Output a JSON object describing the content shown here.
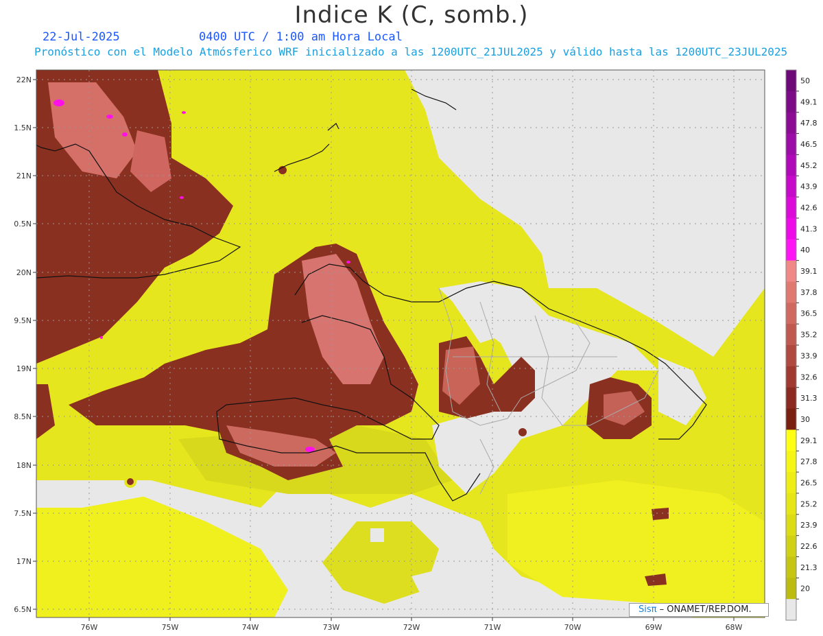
{
  "header": {
    "title": "Indice K (C, somb.)",
    "date": "22-Jul-2025",
    "time": "0400 UTC / 1:00 am Hora Local",
    "model": "Pronóstico con el Modelo Atmósferico WRF inicializado a las 1200UTC_21JUL2025 y válido hasta las  1200UTC_23JUL2025"
  },
  "axes": {
    "lat_labels": [
      "22N",
      "1.5N",
      "21N",
      "0.5N",
      "20N",
      "9.5N",
      "19N",
      "8.5N",
      "18N",
      "7.5N",
      "17N",
      "6.5N"
    ],
    "lon_labels": [
      "76W",
      "75W",
      "74W",
      "73W",
      "72W",
      "71W",
      "70W",
      "69W",
      "68W"
    ]
  },
  "colorbar": {
    "labels": [
      "50",
      "49.1",
      "47.8",
      "46.5",
      "45.2",
      "43.9",
      "42.6",
      "41.3",
      "40",
      "39.1",
      "37.8",
      "36.5",
      "35.2",
      "33.9",
      "32.6",
      "31.3",
      "30",
      "29.1",
      "27.8",
      "26.5",
      "25.2",
      "23.9",
      "22.6",
      "21.3",
      "20"
    ],
    "colors": [
      "#6e0a78",
      "#7d0a86",
      "#8c0b95",
      "#9c0ca6",
      "#b00ab8",
      "#c70ac9",
      "#dc0ad8",
      "#ee0ae8",
      "#ff14f5",
      "#f08888",
      "#e07a70",
      "#d06a60",
      "#c05a50",
      "#b04a40",
      "#a03a30",
      "#8a2a20",
      "#7a2010",
      "#ffff14",
      "#f6f614",
      "#eeee14",
      "#e6e614",
      "#dcdc14",
      "#d0d014",
      "#c6c612",
      "#bcbc10",
      "#e8e8e8"
    ]
  },
  "credit": {
    "brand": "Sisπ",
    "text": "– ONAMET/REP.DOM."
  },
  "colors": {
    "low": "#e8e8e8",
    "yellow": "#e8e820",
    "brown": "#8a3020",
    "salmon": "#d87068",
    "magenta": "#ff10e8"
  }
}
